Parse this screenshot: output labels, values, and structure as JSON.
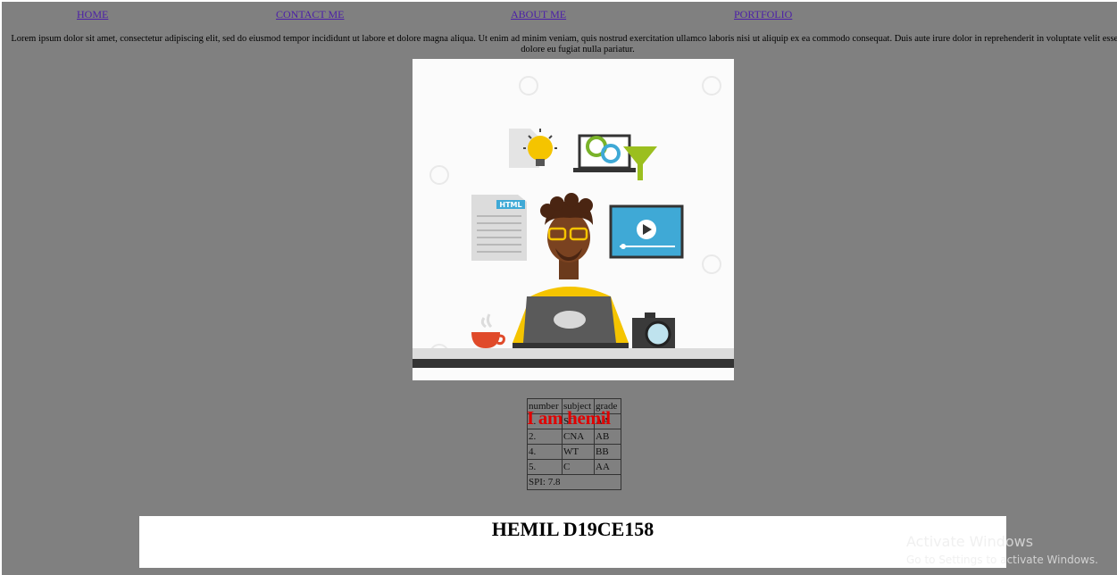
{
  "nav": {
    "home": "HOME",
    "contact": "CONTACT ME",
    "about": "ABOUT ME",
    "portfolio": "PORTFOLIO"
  },
  "intro_text": "Lorem ipsum dolor sit amet, consectetur adipiscing elit, sed do eiusmod tempor incididunt ut labore et dolore magna aliqua. Ut enim ad minim veniam, quis nostrud exercitation ullamco laboris nisi ut aliquip ex ea commodo consequat. Duis aute irure dolor in reprehenderit in voluptate velit esse cillum dolore eu fugiat nulla pariatur.",
  "hero_image": {
    "html_badge": "HTML"
  },
  "table": {
    "headers": [
      "number",
      "subject",
      "grade"
    ],
    "rows": [
      [
        "1.",
        "SC",
        "AA"
      ],
      [
        "2.",
        "CNA",
        "AB"
      ],
      [
        "4.",
        "WT",
        "BB"
      ],
      [
        "5.",
        "C",
        "AA"
      ]
    ],
    "footer": "SPI: 7.8"
  },
  "overlay_heading": "I am hemil",
  "footer_title": "HEMIL D19CE158",
  "watermark": {
    "line1": "Activate Windows",
    "line2": "Go to Settings to activate Windows."
  },
  "colors": {
    "page_bg": "#808080",
    "link": "#4b1ea8",
    "overlay_red": "#e00000"
  }
}
